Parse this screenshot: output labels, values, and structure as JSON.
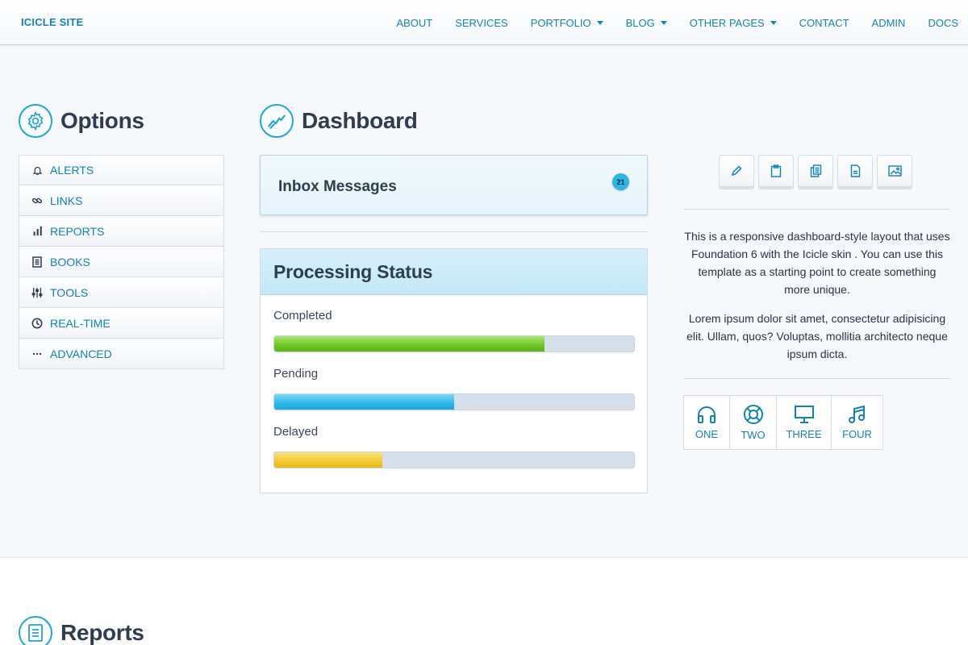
{
  "brand": "ICICLE SITE",
  "nav": [
    {
      "label": "ABOUT",
      "dropdown": false
    },
    {
      "label": "SERVICES",
      "dropdown": false
    },
    {
      "label": "PORTFOLIO",
      "dropdown": true
    },
    {
      "label": "BLOG",
      "dropdown": true
    },
    {
      "label": "OTHER PAGES",
      "dropdown": true
    },
    {
      "label": "CONTACT",
      "dropdown": false
    },
    {
      "label": "ADMIN",
      "dropdown": false
    },
    {
      "label": "DOCS",
      "dropdown": false
    }
  ],
  "options": {
    "title": "Options",
    "icon": "gear-icon",
    "items": [
      {
        "label": "ALERTS",
        "icon": "bell-icon"
      },
      {
        "label": "LINKS",
        "icon": "link-icon"
      },
      {
        "label": "REPORTS",
        "icon": "bar-chart-icon"
      },
      {
        "label": "BOOKS",
        "icon": "book-icon"
      },
      {
        "label": "TOOLS",
        "icon": "sliders-icon"
      },
      {
        "label": "REAL-TIME",
        "icon": "clock-icon"
      },
      {
        "label": "ADVANCED",
        "icon": "more-icon"
      }
    ]
  },
  "dashboard": {
    "title": "Dashboard",
    "icon": "trend-icon",
    "inbox": {
      "label": "Inbox Messages",
      "count": "21"
    },
    "processing": {
      "title": "Processing Status",
      "items": [
        {
          "label": "Completed",
          "progress": 0.75,
          "color": "green"
        },
        {
          "label": "Pending",
          "progress": 0.5,
          "color": "blue"
        },
        {
          "label": "Delayed",
          "progress": 0.3,
          "color": "yellow"
        }
      ]
    }
  },
  "toolbar": {
    "buttons": [
      "pencil-icon",
      "clipboard-icon",
      "copy-icon",
      "document-icon",
      "image-icon"
    ]
  },
  "description": {
    "p1": "This is a responsive dashboard-style layout that uses Foundation 6 with the Icicle skin . You can use this template as a starting point to create something more unique.",
    "p2": "Lorem ipsum dolor sit amet, consectetur adipisicing elit. Ullam, quos? Voluptas, mollitia architecto neque ipsum dicta."
  },
  "icon_buttons": [
    {
      "label": "ONE",
      "icon": "headphones-icon"
    },
    {
      "label": "TWO",
      "icon": "lifebuoy-icon"
    },
    {
      "label": "THREE",
      "icon": "monitor-icon"
    },
    {
      "label": "FOUR",
      "icon": "music-icon"
    }
  ],
  "reports": {
    "title": "Reports",
    "icon": "report-icon"
  },
  "colors": {
    "accent": "#1183b3",
    "circle": "#1ba8d8",
    "heading": "#2e3e50"
  }
}
